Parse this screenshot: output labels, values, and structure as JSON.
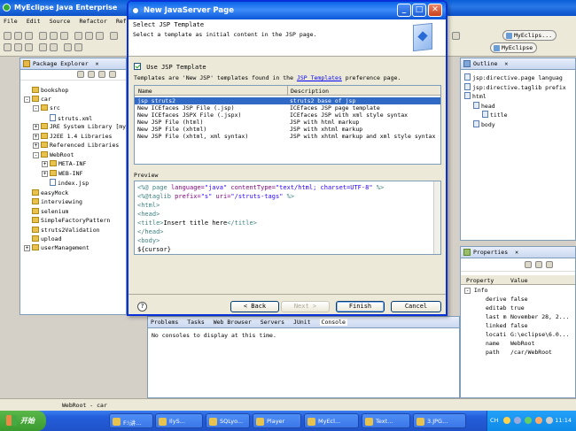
{
  "ide": {
    "title": "MyEclipse Java Enterprise",
    "menu": [
      "File",
      "Edit",
      "Source",
      "Refactor",
      "Refact"
    ],
    "perspectives": [
      "MyEclips...",
      "MyEclipse"
    ]
  },
  "package_explorer": {
    "title": "Package Explorer",
    "tree": [
      {
        "label": "bookshop",
        "indent": 0,
        "icon": "project-icon",
        "pm": ""
      },
      {
        "label": "car",
        "indent": 0,
        "icon": "project-icon",
        "pm": "-"
      },
      {
        "label": "src",
        "indent": 1,
        "icon": "source-folder-icon",
        "pm": "-"
      },
      {
        "label": "struts.xml",
        "indent": 2,
        "icon": "xml-file-icon",
        "pm": ""
      },
      {
        "label": "JRE System Library [my",
        "indent": 1,
        "icon": "library-icon",
        "pm": "+"
      },
      {
        "label": "J2EE 1.4 Libraries",
        "indent": 1,
        "icon": "library-icon",
        "pm": "+"
      },
      {
        "label": "Referenced Libraries",
        "indent": 1,
        "icon": "library-icon",
        "pm": "+"
      },
      {
        "label": "WebRoot",
        "indent": 1,
        "icon": "folder-icon",
        "pm": "-"
      },
      {
        "label": "META-INF",
        "indent": 2,
        "icon": "folder-icon",
        "pm": "+"
      },
      {
        "label": "WEB-INF",
        "indent": 2,
        "icon": "folder-icon",
        "pm": "+"
      },
      {
        "label": "index.jsp",
        "indent": 2,
        "icon": "jsp-file-icon",
        "pm": ""
      },
      {
        "label": "easyMock",
        "indent": 0,
        "icon": "project-icon",
        "pm": ""
      },
      {
        "label": "interviewing",
        "indent": 0,
        "icon": "project-icon",
        "pm": ""
      },
      {
        "label": "selenium",
        "indent": 0,
        "icon": "project-icon",
        "pm": ""
      },
      {
        "label": "SimpleFactoryPattern",
        "indent": 0,
        "icon": "project-icon",
        "pm": ""
      },
      {
        "label": "struts2Validation",
        "indent": 0,
        "icon": "project-icon",
        "pm": ""
      },
      {
        "label": "upload",
        "indent": 0,
        "icon": "project-icon",
        "pm": ""
      },
      {
        "label": "userManagement",
        "indent": 0,
        "icon": "project-icon",
        "pm": "+"
      }
    ]
  },
  "outline": {
    "title": "Outline",
    "tree": [
      {
        "label": "jsp:directive.page languag",
        "indent": 0
      },
      {
        "label": "jsp:directive.taglib prefix",
        "indent": 0
      },
      {
        "label": "html",
        "indent": 0
      },
      {
        "label": "head",
        "indent": 1
      },
      {
        "label": "title",
        "indent": 2
      },
      {
        "label": "body",
        "indent": 1
      }
    ]
  },
  "properties": {
    "title": "Properties",
    "col_property": "Property",
    "col_value": "Value",
    "group": "Info",
    "rows": [
      {
        "k": "derive",
        "v": "false"
      },
      {
        "k": "editab",
        "v": "true"
      },
      {
        "k": "last m",
        "v": "November 28, 2..."
      },
      {
        "k": "linked",
        "v": "false"
      },
      {
        "k": "locati",
        "v": "G:\\eclipse\\6.0..."
      },
      {
        "k": "name",
        "v": "WebRoot"
      },
      {
        "k": "path",
        "v": "/car/WebRoot"
      }
    ]
  },
  "bottom_panel": {
    "tabs": [
      "Problems",
      "Tasks",
      "Web Browser",
      "Servers",
      "JUnit",
      "Console"
    ],
    "message": "No consoles to display at this time."
  },
  "status_text": "WebRoot - car",
  "dialog": {
    "title": "New JavaServer Page",
    "banner_heading": "Select JSP Template",
    "banner_desc": "Select a template as initial content in the JSP page.",
    "use_template_label": "Use JSP Template",
    "use_template_checked": true,
    "info_prefix": "Templates are 'New JSP' templates found in the ",
    "info_link": "JSP Templates",
    "info_suffix": " preference page.",
    "col_name": "Name",
    "col_desc": "Description",
    "templates": [
      {
        "name": "jsp struts2",
        "desc": "struts2 base of jsp",
        "selected": true
      },
      {
        "name": "New ICEfaces JSP File (.jsp)",
        "desc": "ICEfaces JSP page template",
        "selected": false
      },
      {
        "name": "New ICEfaces JSPX File (.jspx)",
        "desc": "ICEfaces JSP with xml style syntax",
        "selected": false
      },
      {
        "name": "New JSP File (html)",
        "desc": "JSP with html markup",
        "selected": false
      },
      {
        "name": "New JSP File (xhtml)",
        "desc": "JSP with xhtml markup",
        "selected": false
      },
      {
        "name": "New JSP File (xhtml, xml syntax)",
        "desc": "JSP with xhtml markup and xml style syntax",
        "selected": false
      }
    ],
    "preview_label": "Preview",
    "preview_lines": [
      [
        {
          "t": "<%@ ",
          "c": "#3f7f7f"
        },
        {
          "t": "page ",
          "c": "#3f7f7f"
        },
        {
          "t": "language=",
          "c": "#7f007f"
        },
        {
          "t": "\"java\" ",
          "c": "#2a00ff"
        },
        {
          "t": "contentType=",
          "c": "#7f007f"
        },
        {
          "t": "\"text/html; charset=UTF-8\" ",
          "c": "#2a00ff"
        },
        {
          "t": "%>",
          "c": "#3f7f7f"
        }
      ],
      [
        {
          "t": "<%@",
          "c": "#3f7f7f"
        },
        {
          "t": "taglib ",
          "c": "#3f7f7f"
        },
        {
          "t": "prefix=",
          "c": "#7f007f"
        },
        {
          "t": "\"s\" ",
          "c": "#2a00ff"
        },
        {
          "t": "uri=",
          "c": "#7f007f"
        },
        {
          "t": "\"/struts-tags\" ",
          "c": "#2a00ff"
        },
        {
          "t": "%>",
          "c": "#3f7f7f"
        }
      ],
      [
        {
          "t": "<html>",
          "c": "#3f7f7f"
        }
      ],
      [
        {
          "t": "<head>",
          "c": "#3f7f7f"
        }
      ],
      [
        {
          "t": "<title>",
          "c": "#3f7f7f"
        },
        {
          "t": "Insert title here",
          "c": "#000000"
        },
        {
          "t": "</title>",
          "c": "#3f7f7f"
        }
      ],
      [
        {
          "t": "</head>",
          "c": "#3f7f7f"
        }
      ],
      [
        {
          "t": "<body>",
          "c": "#3f7f7f"
        }
      ],
      [
        {
          "t": "${cursor}",
          "c": "#000000"
        }
      ]
    ],
    "back_label": "< Back",
    "next_label": "Next >",
    "finish_label": "Finish",
    "cancel_label": "Cancel"
  },
  "taskbar": {
    "start_label": "开始",
    "tasks": [
      "F:\\讲...",
      "IlyS...",
      "SQLyo...",
      "Player",
      "MyEcl...",
      "Text...",
      "3.JPG..."
    ],
    "ime": "CH",
    "clock": "11:14"
  },
  "colors": {
    "accent": "#316ac5",
    "title_bar": "#0a5ed8",
    "link": "#0000ff"
  }
}
